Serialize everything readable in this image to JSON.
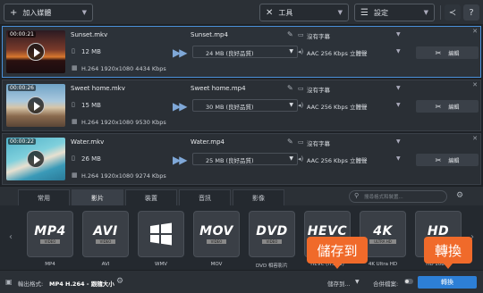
{
  "toolbar": {
    "add_media": "加入媒體",
    "tools": "工具",
    "settings": "設定"
  },
  "files": [
    {
      "time": "00:00:21",
      "name": "Sunset.mkv",
      "size": "12 MB",
      "codec": "H.264 1920x1080 4434 Kbps",
      "out_name": "Sunset.mp4",
      "out_size": "24 MB (良好品質)",
      "subtitle": "沒有字幕",
      "audio": "AAC 256 Kbps 立體聲",
      "edit": "編輯"
    },
    {
      "time": "00:00:26",
      "name": "Sweet home.mkv",
      "size": "15 MB",
      "codec": "H.264 1920x1080 9530 Kbps",
      "out_name": "Sweet home.mp4",
      "out_size": "30 MB (良好品質)",
      "subtitle": "沒有字幕",
      "audio": "AAC 256 Kbps 立體聲",
      "edit": "編輯"
    },
    {
      "time": "00:00:22",
      "name": "Water.mkv",
      "size": "26 MB",
      "codec": "H.264 1920x1080 9274 Kbps",
      "out_name": "Water.mp4",
      "out_size": "25 MB (良好品質)",
      "subtitle": "沒有字幕",
      "audio": "AAC 256 Kbps 立體聲",
      "edit": "編輯"
    }
  ],
  "tabs": [
    "常用",
    "影片",
    "裝置",
    "音訊",
    "影像"
  ],
  "active_tab": "影片",
  "search_placeholder": "搜尋格式和裝置...",
  "formats": [
    {
      "big": "MP4",
      "small": "VIDEO",
      "label": "MP4"
    },
    {
      "big": "AVI",
      "small": "VIDEO",
      "label": "AVI"
    },
    {
      "big": "",
      "small": "",
      "label": "WMV"
    },
    {
      "big": "MOV",
      "small": "VIDEO",
      "label": "MOV"
    },
    {
      "big": "DVD",
      "small": "VIDEO",
      "label": "DVD 相容影片"
    },
    {
      "big": "HEVC",
      "small": "H.265",
      "label": "HEVC (H.265)"
    },
    {
      "big": "4K",
      "small": "ULTRA HD",
      "label": "4K Ultra HD"
    },
    {
      "big": "HD",
      "small": "1080p",
      "label": "HD 1080p"
    }
  ],
  "bottom": {
    "output_prefix": "輸出格式:",
    "output_format": "MP4 H.264 - 跟隨大小",
    "save_to": "儲存到...",
    "merge": "合併檔案:",
    "convert": "轉換"
  },
  "callouts": {
    "save_to": "儲存到",
    "convert": "轉換"
  },
  "colors": {
    "accent": "#2d7fd6",
    "callout": "#f06a2a",
    "selected_border": "#4a90d9"
  }
}
